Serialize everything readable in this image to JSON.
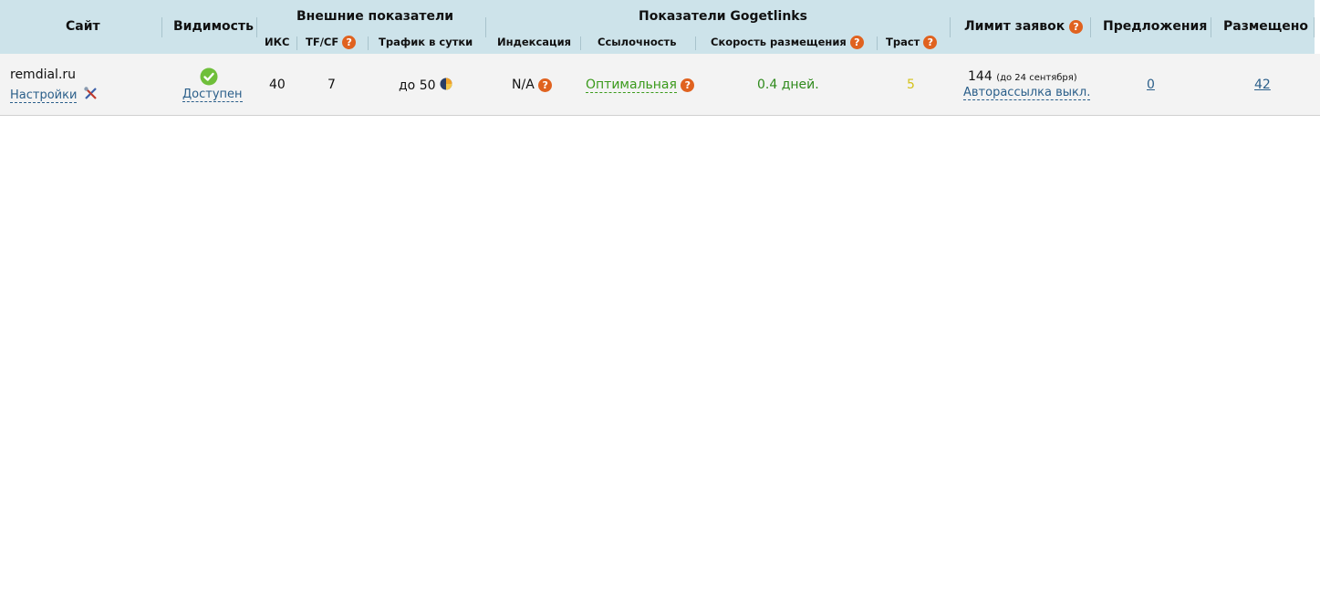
{
  "header": {
    "site": "Сайт",
    "visibility": "Видимость",
    "external_group": "Внешние показатели",
    "iks": "ИКС",
    "tfcf": "TF/CF",
    "traffic": "Трафик в сутки",
    "gogetlinks_group": "Показатели Gogetlinks",
    "indexation": "Индексация",
    "linkness": "Ссылочность",
    "speed": "Скорость размещения",
    "trust": "Траст",
    "limit": "Лимит заявок",
    "offers": "Предложения",
    "placed": "Размещено"
  },
  "row": {
    "site_name": "remdial.ru",
    "settings_label": "Настройки",
    "visibility_status": "Доступен",
    "iks": "40",
    "tfcf": "7",
    "traffic": "до 50",
    "indexation": "N/A",
    "linkness": "Оптимальная",
    "speed": "0.4 дней.",
    "trust": "5",
    "limit_value": "144",
    "limit_date": "(до 24 сентября)",
    "autosend": "Авторассылка выкл.",
    "offers": "0",
    "placed": "42"
  },
  "icons": {
    "help": "question-icon",
    "settings": "tools-icon",
    "status": "check-circle-icon",
    "traffic": "liveinternet-icon"
  },
  "colors": {
    "header_bg": "#cde3ea",
    "row_bg": "#f3f3f3",
    "link": "#2b5f8a",
    "help_icon": "#e0621f",
    "green": "#3a9a1b",
    "trust": "#d4c21a"
  }
}
